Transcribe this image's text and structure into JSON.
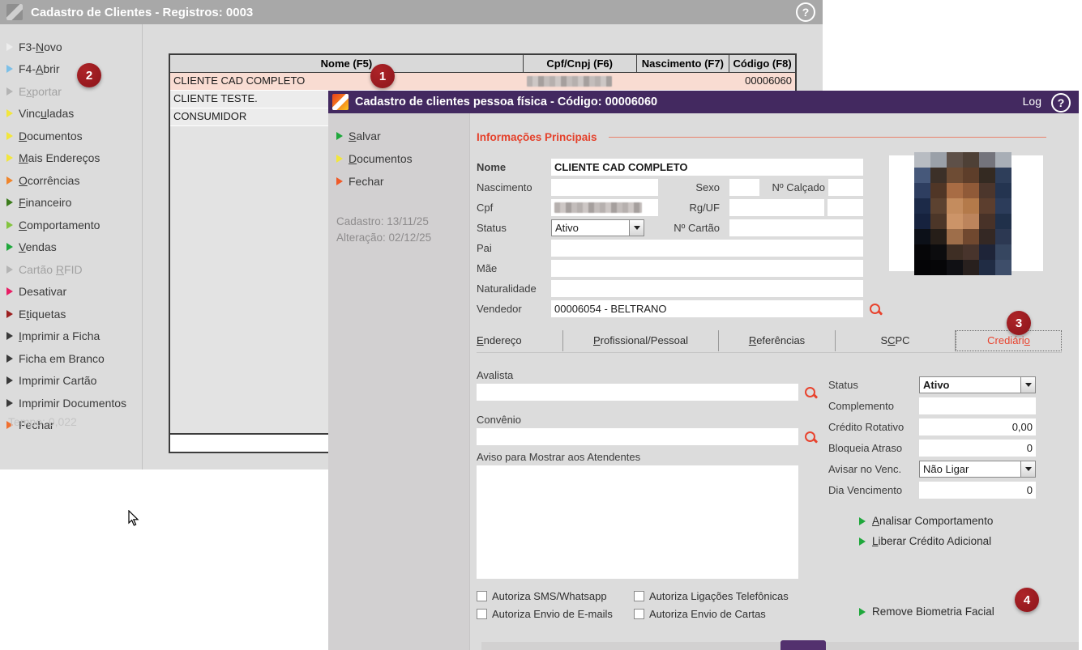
{
  "badges": {
    "b1": "1",
    "b2": "2",
    "b3": "3",
    "b4": "4"
  },
  "colors": {
    "accent_red": "#e5402a",
    "badge_red": "#9a1a1f",
    "title_purple": "#432960",
    "selected_row": "#f9dcd2",
    "link_green": "#1fa83c"
  },
  "bg_window": {
    "title": "Cadastro de Clientes - Registros: 0003",
    "help_glyph": "?",
    "menu": [
      {
        "label": "F3-Novo",
        "u": 3,
        "color": "#ededed",
        "disabled": false
      },
      {
        "label": "F4-Abrir",
        "u": 3,
        "color": "#7cc0e8",
        "disabled": false
      },
      {
        "label": "Exportar",
        "u": 1,
        "color": "#b4b4b4",
        "disabled": true
      },
      {
        "label": "Vinculadas",
        "u": 4,
        "color": "#f2e63c",
        "disabled": false
      },
      {
        "label": "Documentos",
        "u": 0,
        "color": "#f2e63c",
        "disabled": false
      },
      {
        "label": "Mais Endereços",
        "u": 0,
        "color": "#f2e63c",
        "disabled": false
      },
      {
        "label": "Ocorrências",
        "u": 0,
        "color": "#f0852c",
        "disabled": false
      },
      {
        "label": "Financeiro",
        "u": 0,
        "color": "#3c7c1c",
        "disabled": false
      },
      {
        "label": "Comportamento",
        "u": 0,
        "color": "#84c440",
        "disabled": false
      },
      {
        "label": "Vendas",
        "u": 0,
        "color": "#1fa83c",
        "disabled": false
      },
      {
        "label": "Cartão RFID",
        "u": 7,
        "color": "#b4b4b4",
        "disabled": true
      },
      {
        "label": "Desativar",
        "u": -1,
        "color": "#e81e64",
        "disabled": false
      },
      {
        "label": "Etiquetas",
        "u": 1,
        "color": "#9c2020",
        "disabled": false
      },
      {
        "label": "Imprimir a Ficha",
        "u": 0,
        "color": "#3a3a3a",
        "disabled": false
      },
      {
        "label": "Ficha em Branco",
        "u": -1,
        "color": "#3a3a3a",
        "disabled": false
      },
      {
        "label": "Imprimir Cartão",
        "u": -1,
        "color": "#3a3a3a",
        "disabled": false
      },
      {
        "label": "Imprimir Documentos",
        "u": -1,
        "color": "#3a3a3a",
        "disabled": false
      },
      {
        "label": "Fechar",
        "u": -1,
        "color": "#f07030",
        "disabled": false
      }
    ],
    "tempo_label": "Tempo:",
    "tempo_value": "0,022",
    "table": {
      "columns": [
        "Nome (F5)",
        "Cpf/Cnpj (F6)",
        "Nascimento (F7)",
        "Código (F8)"
      ],
      "rows": [
        {
          "nome": "CLIENTE CAD COMPLETO",
          "cpf": "",
          "cpf_redacted": true,
          "nascimento": "",
          "codigo": "00006060",
          "selected": true
        },
        {
          "nome": "CLIENTE TESTE.",
          "cpf": "",
          "cpf_redacted": false,
          "nascimento": "",
          "codigo": "",
          "selected": false
        },
        {
          "nome": "CONSUMIDOR",
          "cpf": "",
          "cpf_redacted": false,
          "nascimento": "",
          "codigo": "",
          "selected": false
        }
      ]
    }
  },
  "modal": {
    "title": "Cadastro de clientes pessoa física - Código: 00006060",
    "log_label": "Log",
    "help_glyph": "?",
    "sidebar": {
      "buttons": [
        {
          "label": "Salvar",
          "u": 0,
          "color": "#1fa83c"
        },
        {
          "label": "Documentos",
          "u": 0,
          "color": "#f2e63c"
        },
        {
          "label": "Fechar",
          "u": -1,
          "color": "#f05a28"
        }
      ],
      "cadastro_text": "Cadastro: 13/11/25",
      "alteracao_text": "Alteração: 02/12/25"
    },
    "info": {
      "title": "Informações Principais",
      "nome_label": "Nome",
      "nome_value": "CLIENTE CAD COMPLETO",
      "nascimento_label": "Nascimento",
      "nascimento_value": "",
      "sexo_label": "Sexo",
      "sexo_value": "",
      "calcado_label": "Nº Calçado",
      "calcado_value": "",
      "cpf_label": "Cpf",
      "cpf_redacted": true,
      "rguf_label": "Rg/UF",
      "rg_value": "",
      "uf_value": "",
      "status_label": "Status",
      "status_value": "Ativo",
      "cartao_label": "Nº Cartão",
      "cartao_value": "",
      "pai_label": "Pai",
      "pai_value": "",
      "mae_label": "Mãe",
      "mae_value": "",
      "naturalidade_label": "Naturalidade",
      "naturalidade_value": "",
      "vendedor_label": "Vendedor",
      "vendedor_value": "00006054 - BELTRANO"
    },
    "tabs": [
      {
        "label": "Endereço",
        "u": 0,
        "active": false
      },
      {
        "label": "Profissional/Pessoal",
        "u": 0,
        "active": false
      },
      {
        "label": "Referências",
        "u": 0,
        "active": false
      },
      {
        "label": "SCPC",
        "u": 1,
        "active": false
      },
      {
        "label": "Crediário",
        "u": 8,
        "active": true
      }
    ],
    "crediario": {
      "avalista_label": "Avalista",
      "avalista_value": "",
      "convenio_label": "Convênio",
      "convenio_value": "",
      "aviso_label": "Aviso para Mostrar aos Atendentes",
      "aviso_value": "",
      "checkboxes": [
        {
          "label": "Autoriza SMS/Whatsapp",
          "checked": false
        },
        {
          "label": "Autoriza Ligações Telefônicas",
          "checked": false
        },
        {
          "label": "Autoriza Envio de E-mails",
          "checked": false
        },
        {
          "label": "Autoriza Envio de Cartas",
          "checked": false
        }
      ],
      "right_fields": [
        {
          "label": "Status",
          "value": "Ativo",
          "type": "select",
          "bold": true
        },
        {
          "label": "Complemento",
          "value": "",
          "type": "text",
          "bold": false
        },
        {
          "label": "Crédito Rotativo",
          "value": "0,00",
          "type": "number",
          "bold": false
        },
        {
          "label": "Bloqueia Atraso",
          "value": "0",
          "type": "number",
          "bold": false
        },
        {
          "label": "Avisar no Venc.",
          "value": "Não Ligar",
          "type": "select",
          "bold": false
        },
        {
          "label": "Dia Vencimento",
          "value": "0",
          "type": "number",
          "bold": false
        }
      ],
      "links": [
        {
          "label": "Analisar Comportamento",
          "u": 0
        },
        {
          "label": "Liberar Crédito Adicional",
          "u": 0
        },
        {
          "label": "Remove Biometria Facial",
          "u": -1
        }
      ]
    },
    "photo_pixels": [
      [
        "#b8bcc2",
        "#9aa0a8",
        "#5e5048",
        "#4e4036",
        "#74747c",
        "#a8aeb6"
      ],
      [
        "#46587a",
        "#3c3028",
        "#6e4c34",
        "#5e3e2a",
        "#342a22",
        "#2e3e5a"
      ],
      [
        "#2e3e60",
        "#503626",
        "#a86c44",
        "#905a38",
        "#4c362c",
        "#243450"
      ],
      [
        "#1c2a48",
        "#5c4230",
        "#c48c5e",
        "#b47a4a",
        "#5c3e2e",
        "#2c3c5a"
      ],
      [
        "#16223e",
        "#4c3628",
        "#cc9468",
        "#bc845c",
        "#483228",
        "#20304a"
      ],
      [
        "#0c1018",
        "#261e18",
        "#9e6e4a",
        "#70482f",
        "#342824",
        "#2c3852"
      ],
      [
        "#060608",
        "#0c0c0e",
        "#3e2e24",
        "#48342c",
        "#1e2438",
        "#364660"
      ],
      [
        "#040406",
        "#060608",
        "#101014",
        "#28201e",
        "#202c44",
        "#3e4e6a"
      ]
    ]
  }
}
